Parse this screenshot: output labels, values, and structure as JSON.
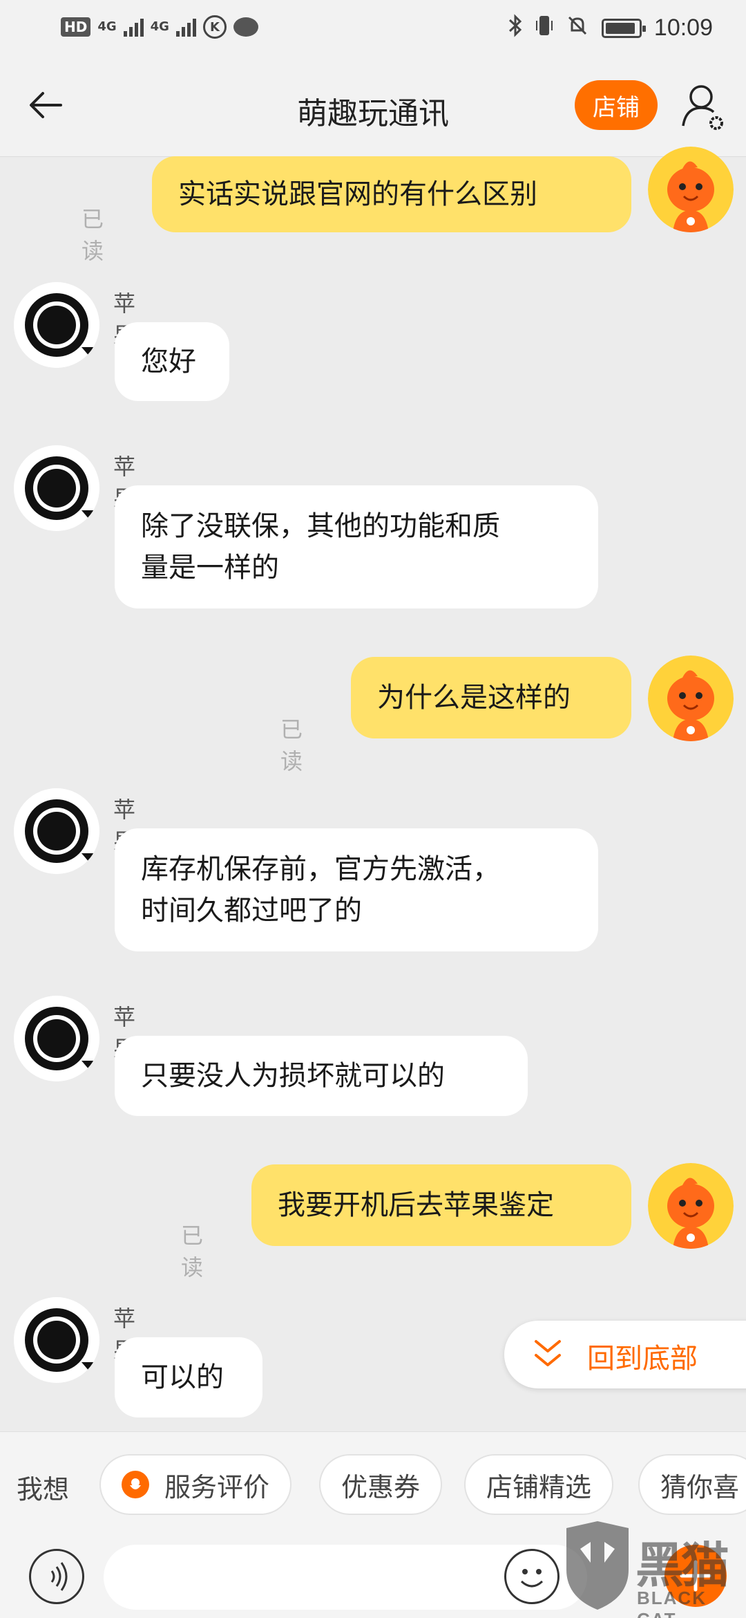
{
  "status_bar": {
    "hd": "HD",
    "network1": "4G",
    "network2": "4G",
    "k_icon": "K",
    "time": "10:09",
    "icons": [
      "bluetooth-icon",
      "vibrate-icon",
      "mute-bell-icon",
      "battery-icon"
    ]
  },
  "header": {
    "title": "萌趣玩通讯",
    "shop_label": "店铺"
  },
  "messages": [
    {
      "side": "mine",
      "read": "已读",
      "text": "实话实说跟官网的有什么区别"
    },
    {
      "side": "theirs",
      "sender": "苹果",
      "text": "您好"
    },
    {
      "side": "theirs",
      "sender": "苹果",
      "line1": "除了没联保，其他的功能和质",
      "line2": "量是一样的"
    },
    {
      "side": "mine",
      "read": "已读",
      "text": "为什么是这样的"
    },
    {
      "side": "theirs",
      "sender": "苹果",
      "line1": "库存机保存前，官方先激活，",
      "line2": "时间久都过吧了的"
    },
    {
      "side": "theirs",
      "sender": "苹果",
      "text": "只要没人为损坏就可以的"
    },
    {
      "side": "mine",
      "read": "已读",
      "text": "我要开机后去苹果鉴定"
    },
    {
      "side": "theirs",
      "sender": "苹果",
      "text": "可以的"
    }
  ],
  "back_to_bottom": "回到底部",
  "quick_bar": {
    "label": "我想",
    "pills": [
      "服务评价",
      "优惠券",
      "店铺精选",
      "猜你喜"
    ]
  },
  "watermark": {
    "cn": "黑猫",
    "en": "BLACK CAT"
  },
  "colors": {
    "accent": "#ff6a00",
    "my_bubble": "#ffe16a",
    "their_bubble": "#ffffff",
    "background": "#ececec"
  }
}
